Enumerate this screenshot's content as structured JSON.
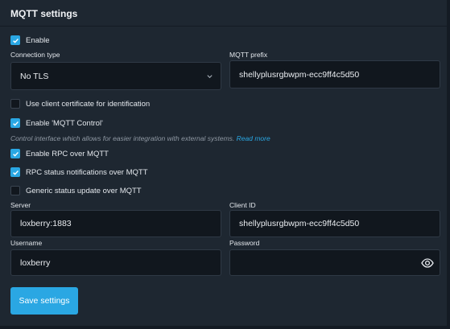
{
  "title": "MQTT settings",
  "enable": {
    "label": "Enable",
    "checked": true
  },
  "connection_type": {
    "label": "Connection type",
    "value": "No TLS"
  },
  "mqtt_prefix": {
    "label": "MQTT prefix",
    "value": "shellyplusrgbwpm-ecc9ff4c5d50"
  },
  "client_cert": {
    "label": "Use client certificate for identification",
    "checked": false
  },
  "mqtt_control": {
    "label": "Enable 'MQTT Control'",
    "checked": true
  },
  "hint": {
    "text": "Control interface which allows for easier integration with external systems.",
    "link": "Read more"
  },
  "rpc": {
    "label": "Enable RPC over MQTT",
    "checked": true
  },
  "rpc_status": {
    "label": "RPC status notifications over MQTT",
    "checked": true
  },
  "generic_status": {
    "label": "Generic status update over MQTT",
    "checked": false
  },
  "server": {
    "label": "Server",
    "value": "loxberry:1883"
  },
  "client_id": {
    "label": "Client ID",
    "value": "shellyplusrgbwpm-ecc9ff4c5d50"
  },
  "username": {
    "label": "Username",
    "value": "loxberry"
  },
  "password": {
    "label": "Password",
    "value": ""
  },
  "save_label": "Save settings",
  "colors": {
    "accent": "#2aa7e3",
    "panel": "#1e2731",
    "field": "#11171e"
  }
}
